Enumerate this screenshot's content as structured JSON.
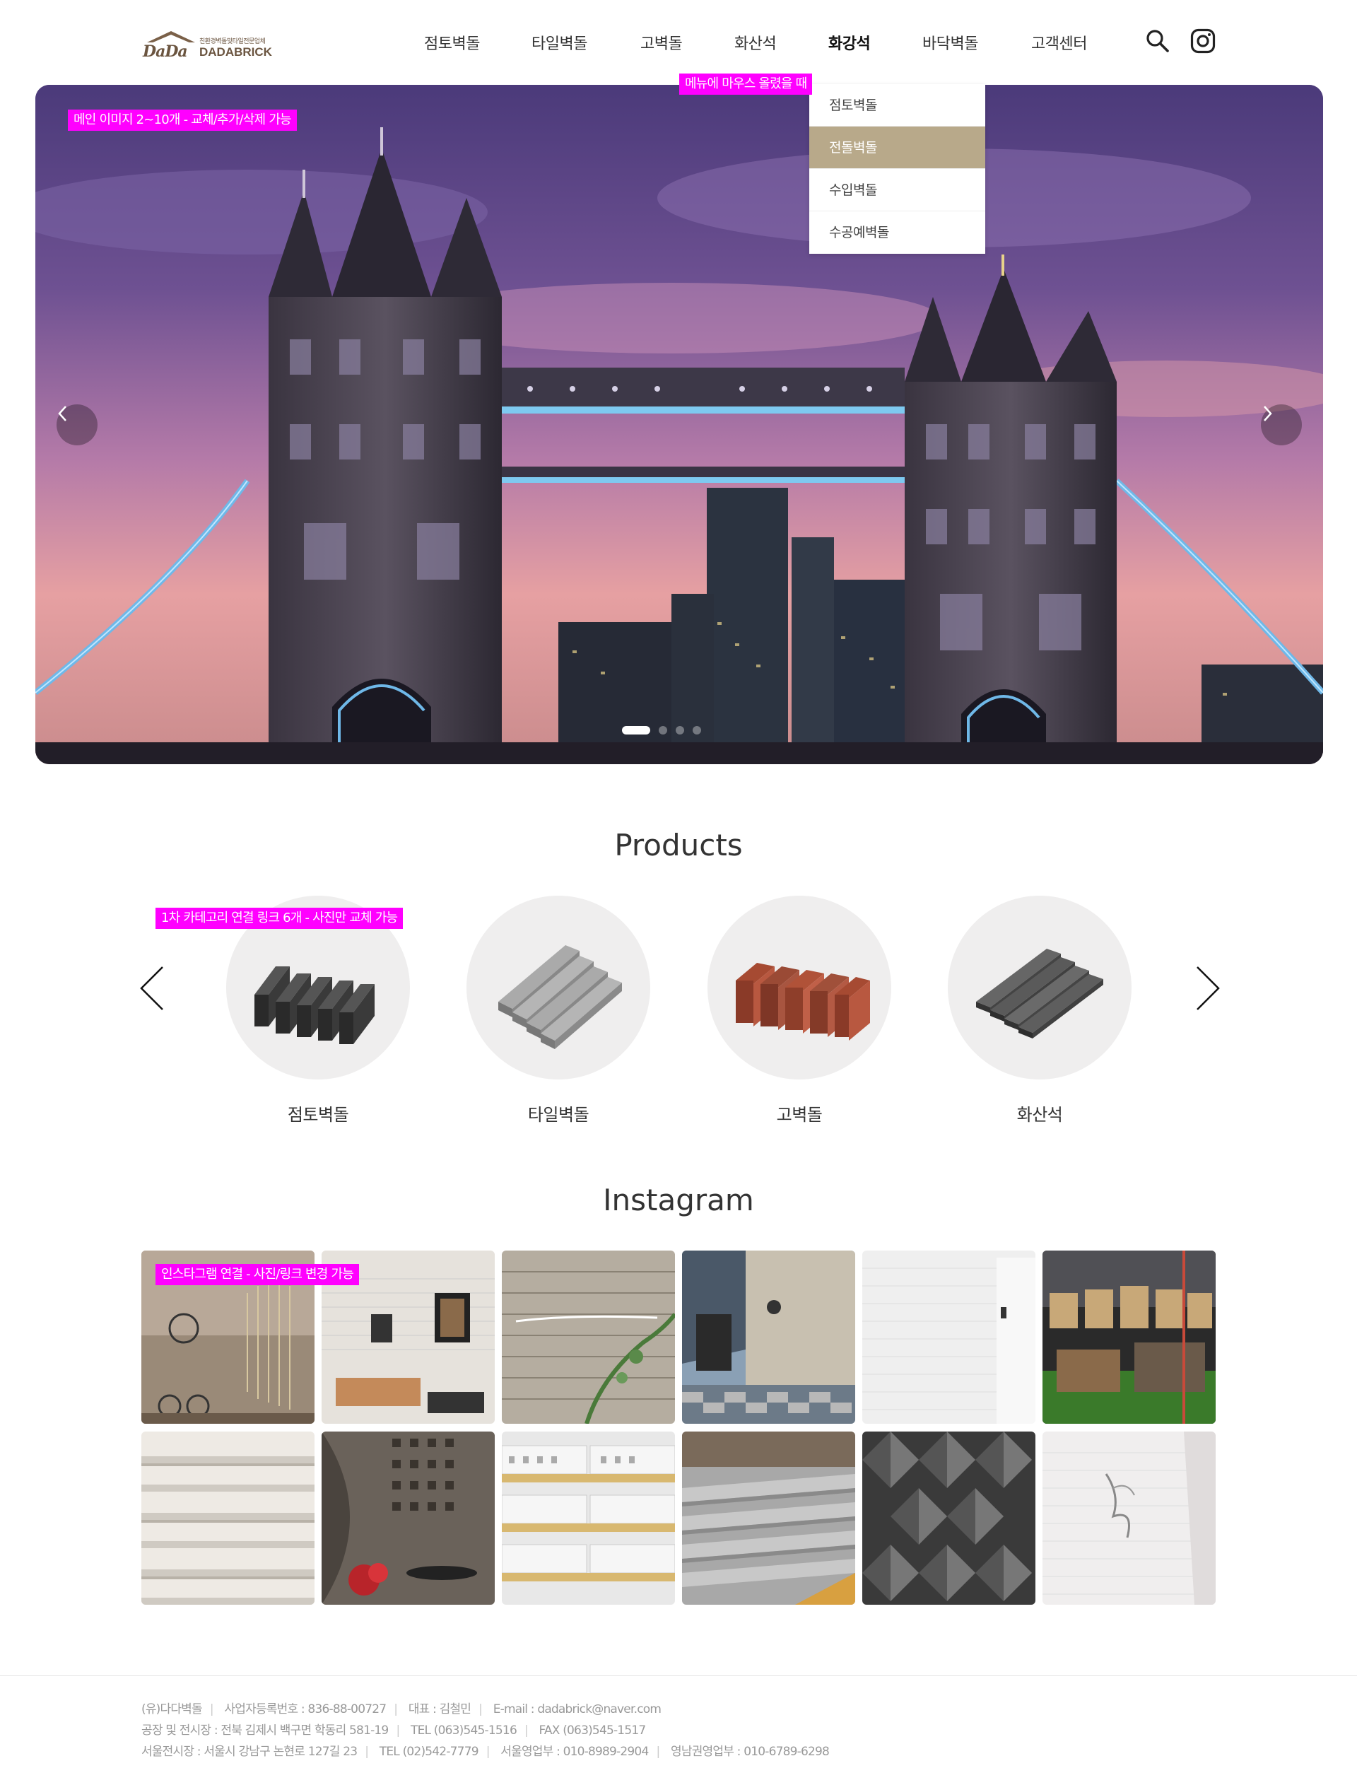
{
  "brand": {
    "sub": "친환경벽돌및타일전문업체",
    "name": "DADABRICK",
    "mark": "DaDa"
  },
  "nav": {
    "items": [
      "점토벽돌",
      "타일벽돌",
      "고벽돌",
      "화산석",
      "화강석",
      "바닥벽돌",
      "고객센터"
    ],
    "active": "화강석",
    "icons": [
      "search-icon",
      "instagram-icon"
    ]
  },
  "dropdown": {
    "items": [
      "점토벽돌",
      "전돌벽돌",
      "수입벽돌",
      "수공예벽돌"
    ],
    "selected": "전돌벽돌",
    "highlight_color": "#b8a98a"
  },
  "annotations": {
    "menu_hover": "메뉴에 마우스 올렸을 때",
    "hero": "메인 이미지 2~10개 - 교체/추가/삭제 가능",
    "products": "1차 카테고리 연결 링크 6개 - 사진만 교체 가능",
    "instagram": "인스타그램 연결 - 사진/링크 변경 가능",
    "color": "#ff00ff"
  },
  "hero": {
    "slide_count": 4,
    "active_slide": 1,
    "controls": [
      "chevron-left-icon",
      "chevron-right-icon"
    ]
  },
  "products": {
    "title": "Products",
    "items": [
      "점토벽돌",
      "타일벽돌",
      "고벽돌",
      "화산석"
    ]
  },
  "instagram": {
    "title": "Instagram",
    "tile_count": 12
  },
  "footer": {
    "line1": [
      "(유)다다벽돌",
      "사업자등록번호 : 836-88-00727",
      "대표 : 김철민",
      "E-mail : dadabrick@naver.com"
    ],
    "line2": [
      "공장 및 전시장 : 전북 김제시 백구면 학동리 581-19",
      "TEL (063)545-1516",
      "FAX (063)545-1517"
    ],
    "line3": [
      "서울전시장 : 서울시 강남구 논현로 127길 23",
      "TEL (02)542-7779",
      "서울영업부 : 010-8989-2904",
      "영남권영업부 : 010-6789-6298"
    ]
  }
}
